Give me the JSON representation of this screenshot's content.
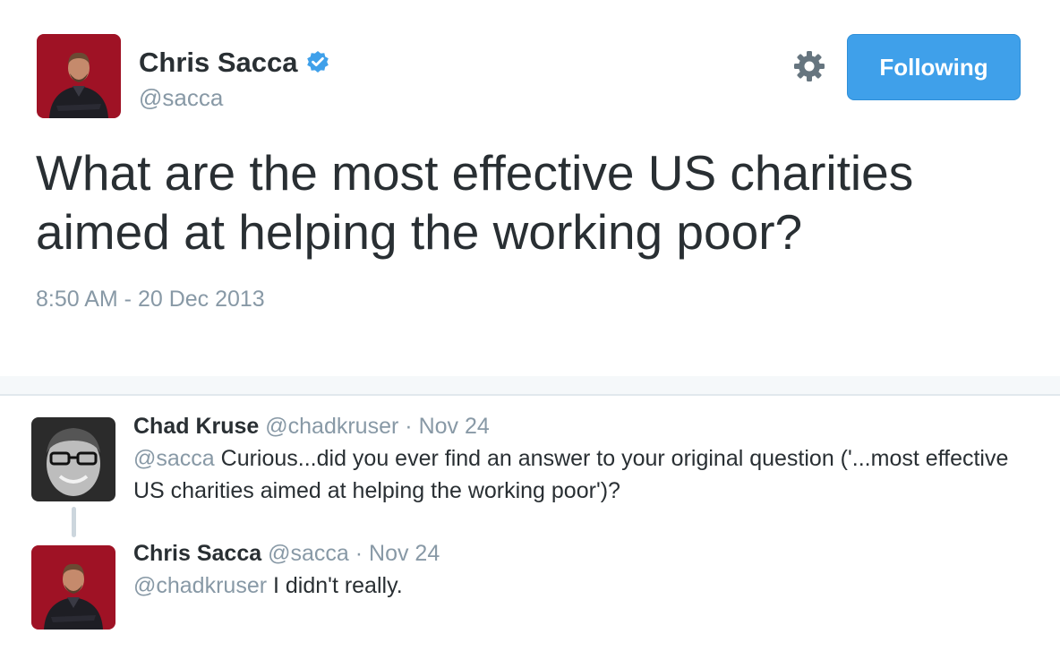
{
  "tweet": {
    "author_name": "Chris Sacca",
    "author_handle": "@sacca",
    "follow_label": "Following",
    "text": "What are the most effective US charities aimed at helping the working poor?",
    "timestamp": "8:50 AM - 20 Dec 2013",
    "accent_color": "#3fa0ea",
    "icons": [
      "verified-icon",
      "gear-icon"
    ]
  },
  "replies": [
    {
      "name": "Chad Kruse",
      "handle": "@chadkruser",
      "separator": "·",
      "date": "Nov 24",
      "mention": "@sacca",
      "text": " Curious...did you ever find an answer to your original question ('...most effective US charities aimed at helping the working poor')?"
    },
    {
      "name": "Chris Sacca",
      "handle": "@sacca",
      "separator": "·",
      "date": "Nov 24",
      "mention": "@chadkruser",
      "text": " I didn't really."
    }
  ]
}
